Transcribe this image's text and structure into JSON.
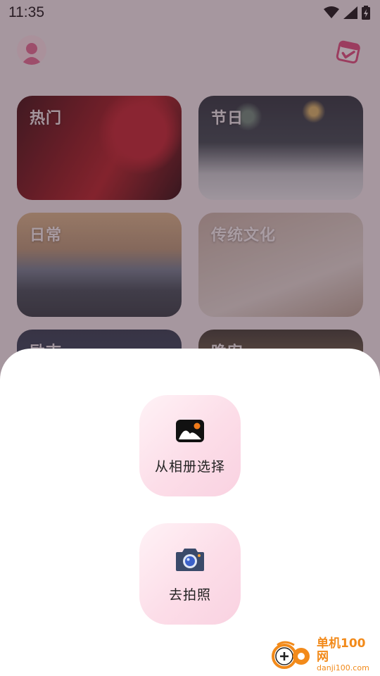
{
  "status_bar": {
    "time": "11:35"
  },
  "categories": [
    {
      "label": "热门",
      "theme": "c-hot"
    },
    {
      "label": "节日",
      "theme": "c-fest"
    },
    {
      "label": "日常",
      "theme": "c-daily"
    },
    {
      "label": "传统文化",
      "theme": "c-culture"
    },
    {
      "label": "励志",
      "theme": "c-inspire"
    },
    {
      "label": "晚安",
      "theme": "c-night"
    }
  ],
  "sheet": {
    "options": [
      {
        "label": "从相册选择",
        "icon": "gallery-icon"
      },
      {
        "label": "去拍照",
        "icon": "camera-icon"
      }
    ]
  },
  "watermark": {
    "brand": "单机100网",
    "url": "danji100.com"
  },
  "colors": {
    "accent_pink": "#f9d2e1",
    "brand_orange": "#f28a1a"
  }
}
